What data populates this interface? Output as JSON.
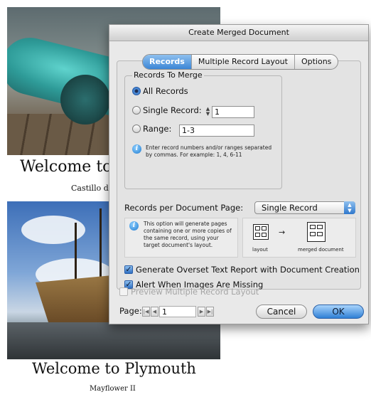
{
  "document": {
    "caption1": "Welcome to",
    "subcaption1": "Castillo de",
    "caption2": "Welcome to Plymouth",
    "subcaption2": "Mayflower II"
  },
  "dialog": {
    "title": "Create Merged Document",
    "tabs": [
      "Records",
      "Multiple Record Layout",
      "Options"
    ],
    "active_tab": "Records",
    "records_to_merge": {
      "group_label": "Records To Merge",
      "all_records_label": "All Records",
      "single_record_label": "Single Record:",
      "single_record_value": "1",
      "range_label": "Range:",
      "range_value": "1-3",
      "selected": "All Records",
      "hint": "Enter record numbers and/or ranges separated by commas. For example: 1, 4, 6-11"
    },
    "records_per_page": {
      "label": "Records per Document Page:",
      "selected": "Single Record",
      "help_text": "This option will generate pages containing one or more copies of the same record, using your target document's layout.",
      "layout_caption": "layout",
      "merged_caption": "merged document"
    },
    "generate_overset": {
      "label": "Generate Overset Text Report with Document Creation",
      "checked": true
    },
    "alert_images": {
      "label": "Alert When Images Are Missing",
      "checked": true
    },
    "preview_layout": {
      "label": "Preview Multiple Record Layout",
      "checked": false,
      "enabled": false
    },
    "page_nav": {
      "label": "Page:",
      "value": "1"
    },
    "cancel_label": "Cancel",
    "ok_label": "OK"
  }
}
